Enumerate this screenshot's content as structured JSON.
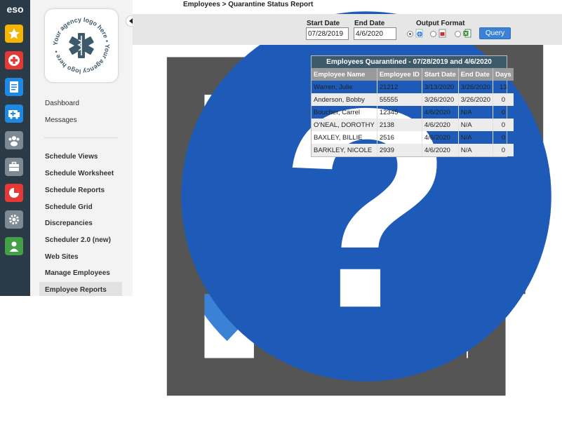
{
  "rail": {
    "brand": "eso"
  },
  "logo": {
    "text": "Your agency logo here • Your agency logo here •"
  },
  "nav": {
    "group1": [
      "Dashboard",
      "Messages"
    ],
    "group2": [
      "Schedule Views",
      "Schedule Worksheet",
      "Schedule Reports",
      "Schedule Grid",
      "Discrepancies",
      "Scheduler 2.0 (new)",
      "Web Sites",
      "Manage Employees",
      "Employee Reports"
    ]
  },
  "breadcrumb": "Employees > Quarantine Status Report",
  "filters": {
    "start_label": "Start Date",
    "start_value": "07/28/2019",
    "end_label": "End Date",
    "end_value": "4/6/2020",
    "format_label": "Output Format",
    "query_label": "Query"
  },
  "report": {
    "title": "Employees Quarantined - 07/28/2019 and 4/6/2020",
    "columns": [
      "Employee Name",
      "Employee ID",
      "Start Date",
      "End Date",
      "Days"
    ],
    "rows": [
      [
        "Warren, Julie",
        "21212",
        "3/13/2020",
        "3/26/2020",
        "13"
      ],
      [
        "Anderson, Bobby",
        "55555",
        "3/26/2020",
        "3/26/2020",
        "0"
      ],
      [
        "Boucher, Carrel",
        "12345",
        "4/6/2020",
        "N/A",
        "0"
      ],
      [
        "O'NEAL, DOROTHY",
        "2138",
        "4/6/2020",
        "N/A",
        "0"
      ],
      [
        "BAXLEY, BILLIE",
        "2516",
        "4/6/2020",
        "N/A",
        "0"
      ],
      [
        "BARKLEY, NICOLE",
        "2939",
        "4/6/2020",
        "N/A",
        "0"
      ]
    ]
  },
  "colors": {
    "rail": "#2b3a47",
    "accent": "#3b82d6",
    "report_header": "#3d5a6b"
  }
}
